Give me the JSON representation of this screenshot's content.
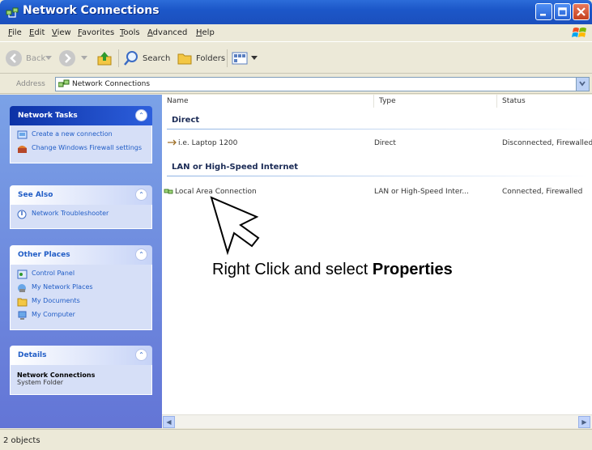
{
  "window": {
    "title": "Network Connections"
  },
  "menu": [
    "File",
    "Edit",
    "View",
    "Favorites",
    "Tools",
    "Advanced",
    "Help"
  ],
  "toolbar": {
    "back_label": "Back",
    "search_label": "Search",
    "folders_label": "Folders"
  },
  "address": {
    "label": "Address",
    "value": "Network Connections"
  },
  "sidebar": {
    "network_tasks": {
      "title": "Network Tasks",
      "items": [
        "Create a new connection",
        "Change Windows Firewall settings"
      ]
    },
    "see_also": {
      "title": "See Also",
      "items": [
        "Network Troubleshooter"
      ]
    },
    "other_places": {
      "title": "Other Places",
      "items": [
        "Control Panel",
        "My Network Places",
        "My Documents",
        "My Computer"
      ]
    },
    "details": {
      "title": "Details",
      "name": "Network Connections",
      "subtitle": "System Folder"
    }
  },
  "columns": {
    "name": "Name",
    "type": "Type",
    "status": "Status"
  },
  "groups": [
    {
      "title": "Direct",
      "rows": [
        {
          "name": "i.e. Laptop 1200",
          "type": "Direct",
          "status": "Disconnected, Firewalled"
        }
      ]
    },
    {
      "title": "LAN or High-Speed Internet",
      "rows": [
        {
          "name": "Local Area Connection",
          "type": "LAN or High-Speed Inter...",
          "status": "Connected, Firewalled"
        }
      ]
    }
  ],
  "annotation": {
    "prefix": "Right Click and select ",
    "emphasis": "Properties"
  },
  "status_bar": {
    "text": "2 objects"
  },
  "colors": {
    "titlebar": "#1c57c8",
    "taskpane": "#6f8ce0",
    "link": "#215dc6"
  }
}
